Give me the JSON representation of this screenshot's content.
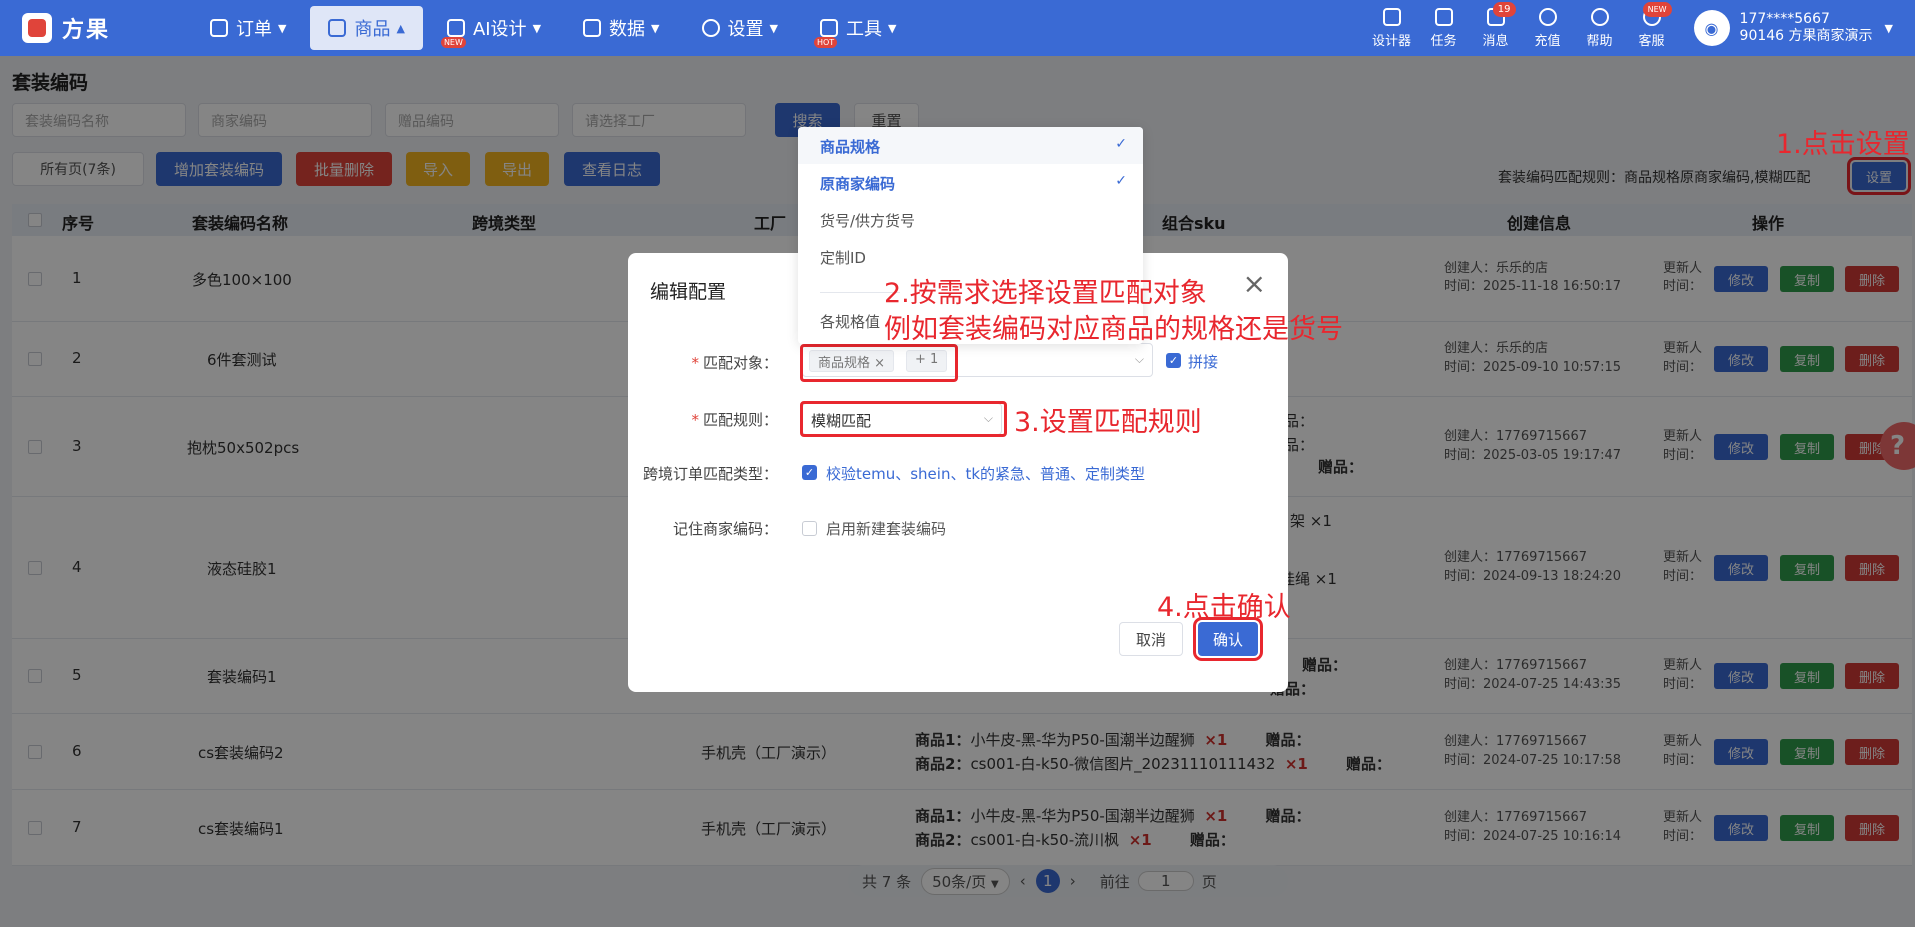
{
  "brand": {
    "name": "方果"
  },
  "nav": [
    {
      "label": "订单",
      "icon": "clipboard-icon",
      "badge": "",
      "active": false
    },
    {
      "label": "商品",
      "icon": "bag-icon",
      "badge": "",
      "active": true
    },
    {
      "label": "AI设计",
      "icon": "ai-icon",
      "badge": "NEW",
      "active": false
    },
    {
      "label": "数据",
      "icon": "chart-icon",
      "badge": "",
      "active": false
    },
    {
      "label": "设置",
      "icon": "gear-icon",
      "badge": "",
      "active": false
    },
    {
      "label": "工具",
      "icon": "cube-icon",
      "badge": "HOT",
      "active": false
    }
  ],
  "tools": [
    {
      "label": "设计器",
      "icon": "image-icon",
      "badge": ""
    },
    {
      "label": "任务",
      "icon": "task-icon",
      "badge": ""
    },
    {
      "label": "消息",
      "icon": "message-icon",
      "badge": "19"
    },
    {
      "label": "充值",
      "icon": "yen-icon",
      "badge": ""
    },
    {
      "label": "帮助",
      "icon": "question-icon",
      "badge": ""
    },
    {
      "label": "客服",
      "icon": "chat-icon",
      "badge": "NEW"
    }
  ],
  "user": {
    "phone": "177****5667",
    "account": "90146 方果商家演示"
  },
  "page": {
    "title": "套装编码",
    "filters": {
      "suit_name": "套装编码名称",
      "merchant_code": "商家编码",
      "gift_code": "赠品编码",
      "factory": "请选择工厂"
    },
    "search_label": "搜索",
    "reset_label": "重置",
    "all_pages_label": "所有页(7条)",
    "add_label": "增加套装编码",
    "batch_delete_label": "批量删除",
    "import_label": "导入",
    "export_label": "导出",
    "log_label": "查看日志",
    "rule_text": "套装编码匹配规则：商品规格原商家编码,模糊匹配",
    "setting_label": "设置"
  },
  "table": {
    "headers": {
      "no": "序号",
      "name": "套装编码名称",
      "cross": "跨境类型",
      "factory": "工厂",
      "sku": "组合sku",
      "created": "创建信息",
      "ops": "操作"
    },
    "edit_label": "修改",
    "copy_label": "复制",
    "delete_label": "删除",
    "rows": [
      {
        "no": "1",
        "name": "多色100×100",
        "factory": "",
        "creator": "创建人：乐乐的店",
        "time": "时间：2025-11-18 16:50:17",
        "updater": "更新人",
        "utime": "时间："
      },
      {
        "no": "2",
        "name": "6件套测试",
        "factory": "",
        "creator": "创建人：乐乐的店",
        "time": "时间：2025-09-10 10:57:15",
        "updater": "更新人",
        "utime": "时间："
      },
      {
        "no": "3",
        "name": "抱枕50x502pcs",
        "factory": "",
        "creator": "创建人：17769715667",
        "time": "时间：2025-03-05 19:17:47",
        "updater": "更新人",
        "utime": "时间："
      },
      {
        "no": "4",
        "name": "液态硅胶1",
        "factory": "",
        "creator": "创建人：17769715667",
        "time": "时间：2024-09-13 18:24:20",
        "updater": "更新人",
        "utime": "时间："
      },
      {
        "no": "5",
        "name": "套装编码1",
        "factory": "",
        "creator": "创建人：17769715667",
        "time": "时间：2024-07-25 14:43:35",
        "updater": "更新人",
        "utime": "时间："
      },
      {
        "no": "6",
        "name": "cs套装编码2",
        "factory": "手机壳（工厂演示）",
        "creator": "创建人：17769715667",
        "time": "时间：2024-07-25 10:17:58",
        "updater": "更新人",
        "utime": "时间："
      },
      {
        "no": "7",
        "name": "cs套装编码1",
        "factory": "手机壳（工厂演示）",
        "creator": "创建人：17769715667",
        "time": "时间：2024-07-25 10:16:14",
        "updater": "更新人",
        "utime": "时间："
      }
    ],
    "sku_fragments": {
      "r3a": "品：",
      "r3b": "品：",
      "r3c": "赠品：",
      "r4a": "架 ×1",
      "r4b": "挂绳 ×1",
      "r5a": "赠品：",
      "r5b": "赠品：",
      "r6_l1_label": "商品1：",
      "r6_l1_name": "小牛皮-黑-华为P50-国潮半边醒狮",
      "r6_l1_qty": "×1",
      "r6_l1_gift": "赠品：",
      "r6_l2_label": "商品2：",
      "r6_l2_name": "cs001-白-k50-微信图片_20231110111432",
      "r6_l2_qty": "×1",
      "r6_l2_gift": "赠品：",
      "r7_l1_label": "商品1：",
      "r7_l1_name": "小牛皮-黑-华为P50-国潮半边醒狮",
      "r7_l1_qty": "×1",
      "r7_l1_gift": "赠品：",
      "r7_l2_label": "商品2：",
      "r7_l2_name": "cs001-白-k50-流川枫",
      "r7_l2_qty": "×1",
      "r7_l2_gift": "赠品："
    }
  },
  "pager": {
    "total": "共 7 条",
    "size": "50条/页",
    "current": "1",
    "goto": "前往",
    "page_input": "1",
    "page_unit": "页"
  },
  "modal": {
    "title": "编辑配置",
    "match_object_label": "匹配对象：",
    "match_object_chip": "商品规格",
    "match_object_more": "+ 1",
    "concat_label": "拼接",
    "match_rule_label": "匹配规则：",
    "match_rule_value": "模糊匹配",
    "cross_label": "跨境订单匹配类型：",
    "cross_value": "校验temu、shein、tk的紧急、普通、定制类型",
    "remember_label": "记住商家编码：",
    "remember_value": "启用新建套装编码",
    "cancel_label": "取消",
    "confirm_label": "确认"
  },
  "dropdown": {
    "options": [
      {
        "label": "商品规格",
        "selected": true
      },
      {
        "label": "原商家编码",
        "selected": true
      },
      {
        "label": "货号/供方货号",
        "selected": false
      },
      {
        "label": "定制ID",
        "selected": false
      },
      {
        "label": "各规格值",
        "selected": false
      }
    ]
  },
  "annotations": {
    "a1": "1.点击设置",
    "a2_line1": "2.按需求选择设置匹配对象",
    "a2_line2": "例如套装编码对应商品的规格还是货号",
    "a3": "3.设置匹配规则",
    "a4": "4.点击确认"
  },
  "colors": {
    "primary": "#3a6ad4",
    "danger": "#e0443a",
    "success": "#2e9c4b",
    "warning": "#f3b520",
    "annotation": "#e8272e"
  }
}
